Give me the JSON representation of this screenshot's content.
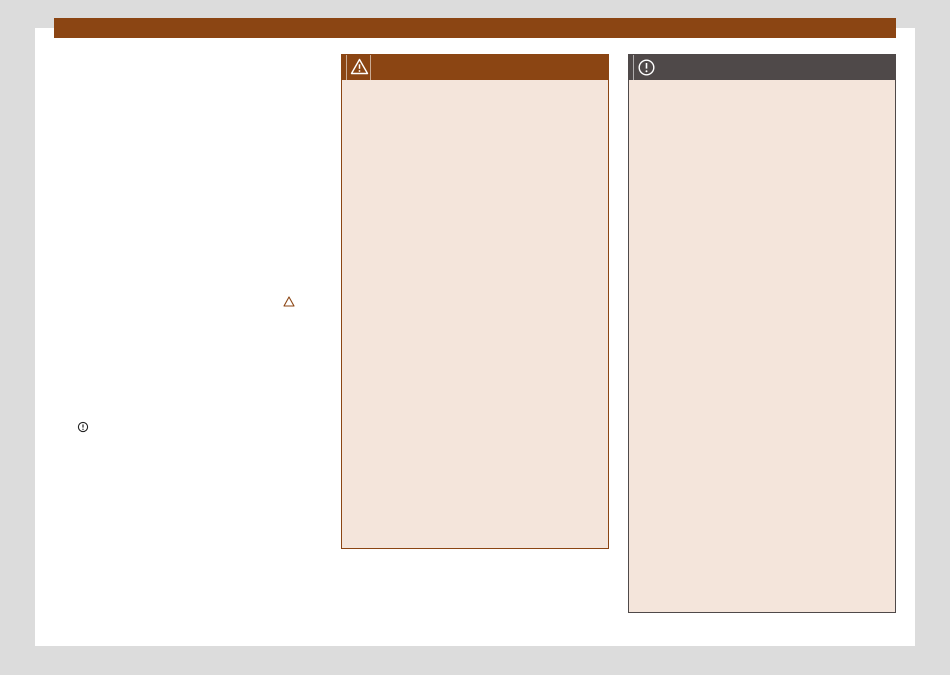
{
  "page": {
    "colors": {
      "background": "#dcdcdc",
      "sheet": "#ffffff",
      "accent": "#8b4513",
      "warning_panel": "#f4e5db",
      "notice_header": "#4f4949"
    }
  },
  "body_text": {
    "warning_reference_icon": "warning-triangle-icon",
    "notice_reference_icon": "notice-circle-icon"
  },
  "warning_box": {
    "icon": "warning-triangle-icon"
  },
  "notice_box": {
    "icon": "notice-circle-icon"
  }
}
